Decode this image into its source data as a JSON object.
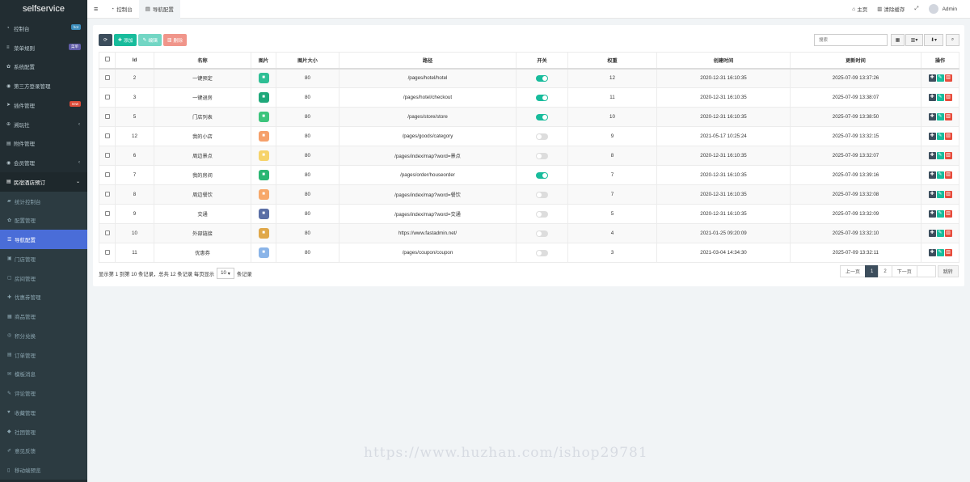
{
  "app": {
    "title": "selfservice"
  },
  "sidebar": {
    "items": [
      {
        "label": "控制台",
        "icon": "dashboard-icon",
        "badge": "hot",
        "badge_color": "#3c8dbc",
        "type": "top"
      },
      {
        "label": "菜单规则",
        "icon": "menu-icon",
        "badge": "菜单",
        "badge_color": "#605ca8",
        "type": "top"
      },
      {
        "label": "系统配置",
        "icon": "gear-icon",
        "type": "top"
      },
      {
        "label": "第三方登录管理",
        "icon": "user-icon",
        "type": "top"
      },
      {
        "label": "插件管理",
        "icon": "rocket-icon",
        "badge": "new",
        "badge_color": "#dd4b39",
        "type": "top"
      },
      {
        "label": "溯玩社",
        "icon": "link-icon",
        "caret": "‹",
        "type": "top"
      },
      {
        "label": "附件管理",
        "icon": "file-icon",
        "type": "top"
      },
      {
        "label": "会员管理",
        "icon": "member-icon",
        "caret": "‹",
        "type": "top"
      },
      {
        "label": "民宿酒店预订",
        "icon": "list-icon",
        "caret": "⌄",
        "type": "group"
      },
      {
        "label": "统计控制台",
        "icon": "chart-icon",
        "type": "sub"
      },
      {
        "label": "配置管理",
        "icon": "gear-icon",
        "type": "sub"
      },
      {
        "label": "导航配置",
        "icon": "nav-icon",
        "type": "active"
      },
      {
        "label": "门店管理",
        "icon": "store-icon",
        "type": "sub"
      },
      {
        "label": "房间管理",
        "icon": "room-icon",
        "type": "sub"
      },
      {
        "label": "优惠券管理",
        "icon": "coupon-icon",
        "type": "sub"
      },
      {
        "label": "商品管理",
        "icon": "goods-icon",
        "type": "sub"
      },
      {
        "label": "积分兑换",
        "icon": "points-icon",
        "type": "sub"
      },
      {
        "label": "订单管理",
        "icon": "order-icon",
        "type": "sub"
      },
      {
        "label": "模板消息",
        "icon": "message-icon",
        "type": "sub"
      },
      {
        "label": "评论管理",
        "icon": "comment-icon",
        "type": "sub"
      },
      {
        "label": "收藏管理",
        "icon": "heart-icon",
        "type": "sub"
      },
      {
        "label": "社团管理",
        "icon": "group-icon",
        "type": "sub"
      },
      {
        "label": "意见反馈",
        "icon": "feedback-icon",
        "type": "sub"
      },
      {
        "label": "移动端预览",
        "icon": "mobile-icon",
        "type": "sub"
      }
    ]
  },
  "topbar": {
    "menu_icon": "≡",
    "tabs": [
      {
        "label": "控制台",
        "icon": "dashboard-icon"
      },
      {
        "label": "导航配置",
        "icon": "nav-icon"
      }
    ],
    "home": "主页",
    "clear_cache": "清除缓存",
    "user": "Admin"
  },
  "toolbar": {
    "refresh": "⟳",
    "add": "添加",
    "edit": "编辑",
    "delete": "删除",
    "search_placeholder": "搜索",
    "add_color": "#18bc9c",
    "edit_color": "#72d6c4",
    "delete_color": "#f0958a",
    "refresh_color": "#3c4d5c"
  },
  "table": {
    "headers": [
      "Id",
      "名称",
      "图片",
      "图片大小",
      "路径",
      "开关",
      "权重",
      "创建时间",
      "更新时间",
      "操作"
    ],
    "rows": [
      {
        "id": "2",
        "name": "一键预定",
        "pic_color": "#2fbf95",
        "pic_icon": "house-icon",
        "size": "80",
        "path": "/pages/hotel/hotel",
        "on": true,
        "weight": "12",
        "created": "2020-12-31 16:10:35",
        "updated": "2025-07-09 13:37:26"
      },
      {
        "id": "3",
        "name": "一键退房",
        "pic_color": "#1fa87a",
        "pic_icon": "checkout-icon",
        "size": "80",
        "path": "/pages/hotel/checkout",
        "on": true,
        "weight": "11",
        "created": "2020-12-31 16:10:35",
        "updated": "2025-07-09 13:38:07"
      },
      {
        "id": "5",
        "name": "门店列表",
        "pic_color": "#3cc47c",
        "pic_icon": "store-icon",
        "size": "80",
        "path": "/pages/store/store",
        "on": true,
        "weight": "10",
        "created": "2020-12-31 16:10:35",
        "updated": "2025-07-09 13:38:50"
      },
      {
        "id": "12",
        "name": "我的小店",
        "pic_color": "#f5a06b",
        "pic_icon": "shop-icon",
        "size": "80",
        "path": "/pages/goods/category",
        "on": false,
        "weight": "9",
        "created": "2021-05-17 10:25:24",
        "updated": "2025-07-09 13:32:15"
      },
      {
        "id": "6",
        "name": "周边景点",
        "pic_color": "#f6d36a",
        "pic_icon": "location-icon",
        "size": "80",
        "path": "/pages/index/map?word=景点",
        "on": false,
        "weight": "8",
        "created": "2020-12-31 16:10:35",
        "updated": "2025-07-09 13:32:07"
      },
      {
        "id": "7",
        "name": "我的房间",
        "pic_color": "#2bb673",
        "pic_icon": "door-icon",
        "size": "80",
        "path": "/pages/order/houseorder",
        "on": true,
        "weight": "7",
        "created": "2020-12-31 16:10:35",
        "updated": "2025-07-09 13:39:16"
      },
      {
        "id": "8",
        "name": "周边餐饮",
        "pic_color": "#f7a86a",
        "pic_icon": "food-icon",
        "size": "80",
        "path": "/pages/index/map?word=餐饮",
        "on": false,
        "weight": "7",
        "created": "2020-12-31 16:10:35",
        "updated": "2025-07-09 13:32:08"
      },
      {
        "id": "9",
        "name": "交通",
        "pic_color": "#5b6fa6",
        "pic_icon": "traffic-icon",
        "size": "80",
        "path": "/pages/index/map?word=交通",
        "on": false,
        "weight": "5",
        "created": "2020-12-31 16:10:35",
        "updated": "2025-07-09 13:32:09"
      },
      {
        "id": "10",
        "name": "外部链接",
        "pic_color": "#e0a84a",
        "pic_icon": "link-icon",
        "size": "80",
        "path": "https://www.fastadmin.net/",
        "on": false,
        "weight": "4",
        "created": "2021-01-25 09:20:09",
        "updated": "2025-07-09 13:32:10"
      },
      {
        "id": "11",
        "name": "优惠券",
        "pic_color": "#8ab4e8",
        "pic_icon": "coupon-icon",
        "size": "80",
        "path": "/pages/coupon/coupon",
        "on": false,
        "weight": "3",
        "created": "2021-03-04 14:34:30",
        "updated": "2025-07-09 13:32:11"
      }
    ]
  },
  "pagination": {
    "info": "显示第 1 到第 10 条记录，总共 12 条记录 每页显示",
    "per_page": "10",
    "suffix": "条记录",
    "prev": "上一页",
    "pages": [
      "1",
      "2"
    ],
    "current": "1",
    "next": "下一页",
    "jump": "跳转"
  },
  "watermark": "https://www.huzhan.com/ishop29781"
}
